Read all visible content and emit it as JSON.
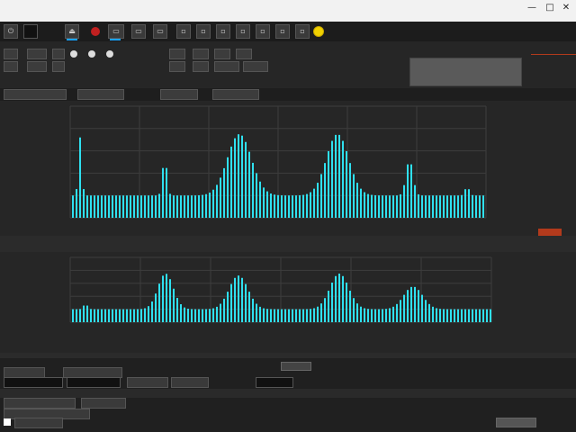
{
  "window": {
    "title": "",
    "subtitle": "",
    "controls": [
      "—",
      "□",
      "✕"
    ]
  },
  "toolbar": {
    "buttons": [
      {
        "name": "power",
        "glyph": "⏻"
      },
      {
        "name": "record",
        "glyph": ""
      },
      {
        "name": "eject",
        "glyph": "⏏"
      },
      {
        "name": "stop-record",
        "glyph": ""
      },
      {
        "name": "display-a",
        "glyph": "▭"
      },
      {
        "name": "display-b",
        "glyph": "▭"
      },
      {
        "name": "meter",
        "glyph": "▭"
      },
      {
        "name": "tool-1",
        "glyph": "▫"
      },
      {
        "name": "tool-2",
        "glyph": "▫"
      },
      {
        "name": "tool-3",
        "glyph": "▫"
      },
      {
        "name": "tool-4",
        "glyph": "▫"
      },
      {
        "name": "tool-5",
        "glyph": "▫"
      },
      {
        "name": "tool-6",
        "glyph": "▫"
      },
      {
        "name": "tool-7",
        "glyph": "▫"
      },
      {
        "name": "tool-8",
        "glyph": "▫"
      },
      {
        "name": "tool-9",
        "glyph": "▫"
      }
    ]
  },
  "controls": {
    "row1": [
      "",
      "",
      "",
      "",
      "",
      "",
      ""
    ],
    "row2": [
      "",
      "",
      "",
      "",
      "",
      "",
      ""
    ],
    "status_lines": [
      "",
      "",
      ""
    ],
    "status_colors": [
      "#4caf50",
      "#2fd1ff",
      "#f1a019"
    ]
  },
  "charts": [],
  "readout": "",
  "bottom": {
    "labels": [
      "",
      "",
      "",
      ""
    ],
    "button": ""
  },
  "colors": {
    "accent": "#2fe0f0",
    "alert": "#b23a1c"
  }
}
